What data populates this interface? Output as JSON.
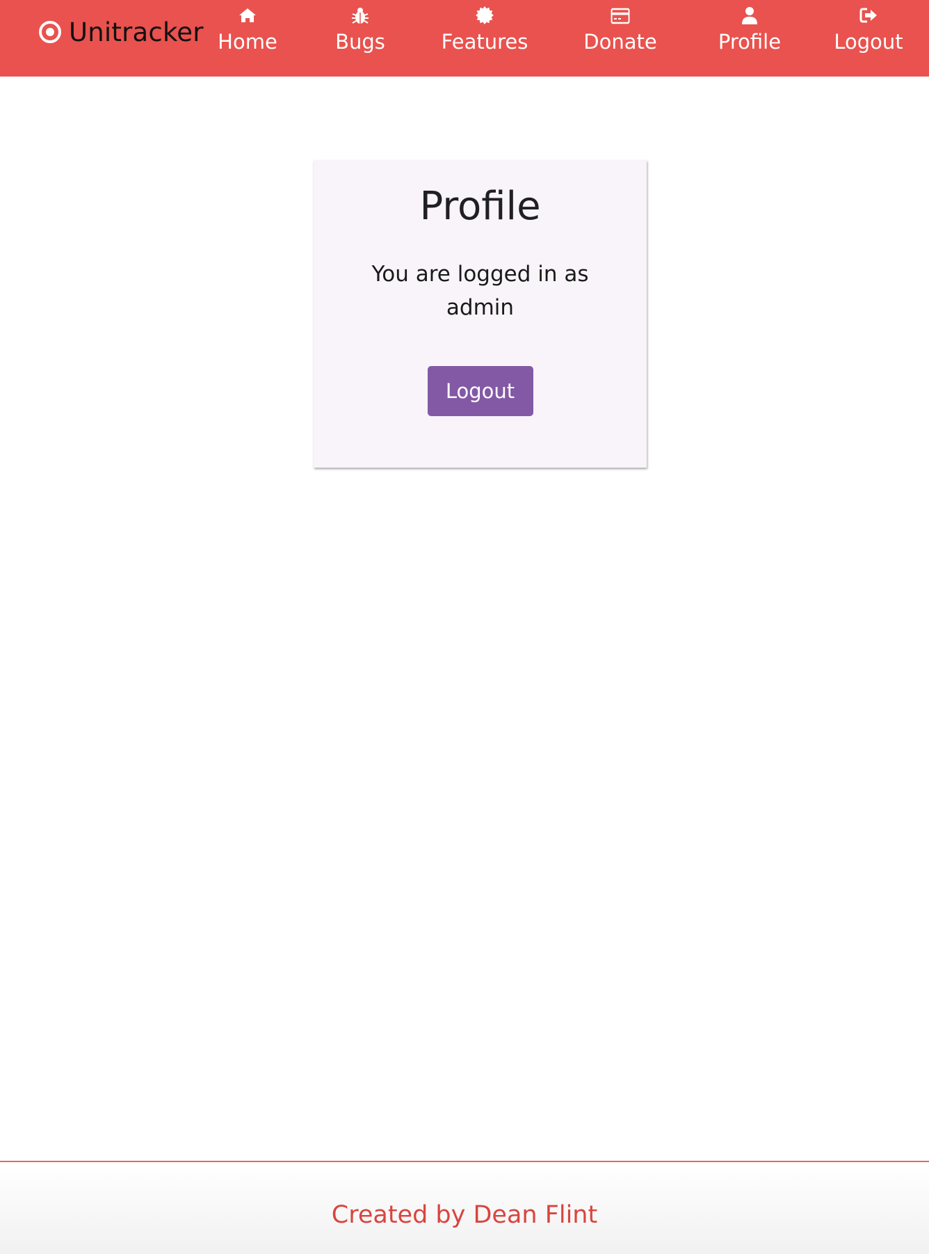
{
  "colors": {
    "navbar_bg": "#e9524e",
    "nav_text": "#ffffff",
    "card_bg": "#f9f4fa",
    "button_bg": "#8359a5",
    "footer_text": "#d9443f"
  },
  "navbar": {
    "brand": {
      "icon": "target-icon",
      "label": "Unitracker"
    },
    "items": [
      {
        "icon": "home-icon",
        "label": "Home"
      },
      {
        "icon": "bug-icon",
        "label": "Bugs"
      },
      {
        "icon": "certificate-icon",
        "label": "Features"
      },
      {
        "icon": "credit-card-icon",
        "label": "Donate"
      },
      {
        "icon": "user-icon",
        "label": "Profile"
      },
      {
        "icon": "logout-icon",
        "label": "Logout"
      }
    ]
  },
  "profile_card": {
    "title": "Profile",
    "message": "You are logged in as admin",
    "logout_button": "Logout"
  },
  "footer": {
    "text": "Created by Dean Flint"
  }
}
